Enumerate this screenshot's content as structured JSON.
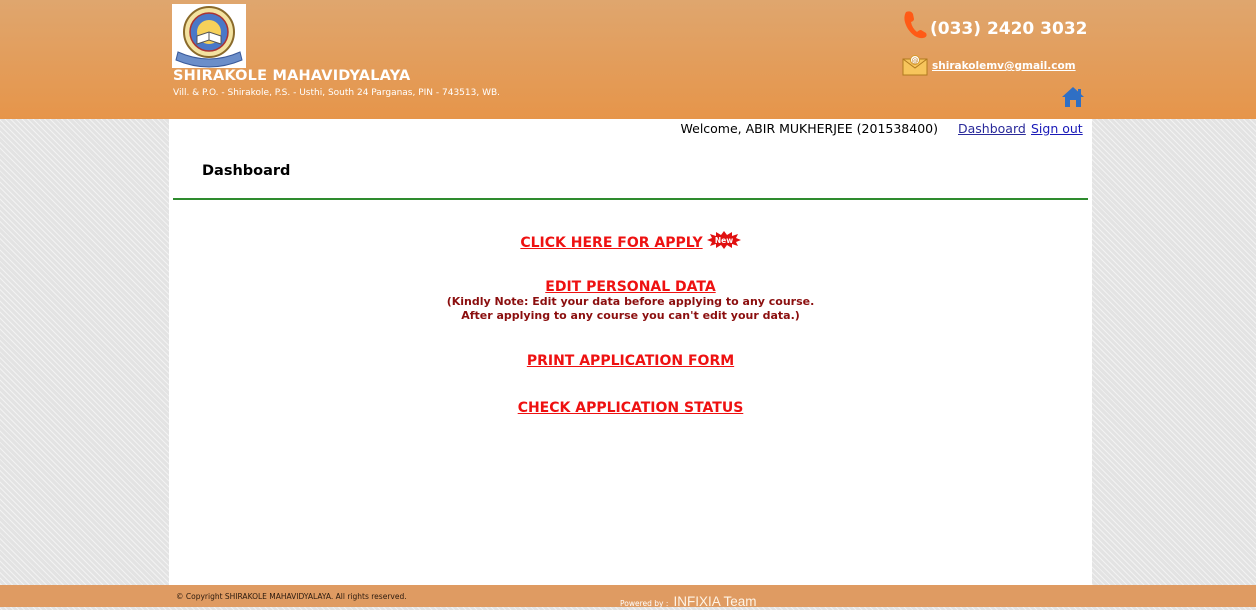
{
  "header": {
    "college_name": "SHIRAKOLE MAHAVIDYALAYA",
    "address": "Vill. & P.O. - Shirakole, P.S. - Usthi, South 24 Parganas, PIN - 743513, WB.",
    "phone": "(033) 2420 3032",
    "email": "shirakolemv@gmail.com",
    "icons": {
      "logo": "college-seal",
      "phone": "phone-icon",
      "mail": "mail-icon",
      "home": "home-icon"
    },
    "colors": {
      "bar": "#e6954a",
      "bar_top": "#dfa66e"
    }
  },
  "nav": {
    "welcome": "Welcome, ABIR MUKHERJEE (201538400)",
    "dashboard": "Dashboard",
    "signout": "Sign out"
  },
  "main": {
    "title": "Dashboard",
    "apply": "CLICK HERE FOR APPLY",
    "new_badge": "New",
    "edit": "EDIT PERSONAL DATA",
    "edit_note_1": "(Kindly Note: Edit your data before applying to any course.",
    "edit_note_2": "After applying to any course you can't edit your data.)",
    "print": "PRINT APPLICATION FORM",
    "status": "CHECK APPLICATION STATUS",
    "colors": {
      "link": "#ee1111",
      "note": "#8b0e0e",
      "divider": "#2e8b2e"
    }
  },
  "footer": {
    "copyright": "© Copyright SHIRAKOLE MAHAVIDYALAYA. All rights reserved.",
    "powered_by": "Powered by :",
    "team": "INFIXIA Team"
  }
}
